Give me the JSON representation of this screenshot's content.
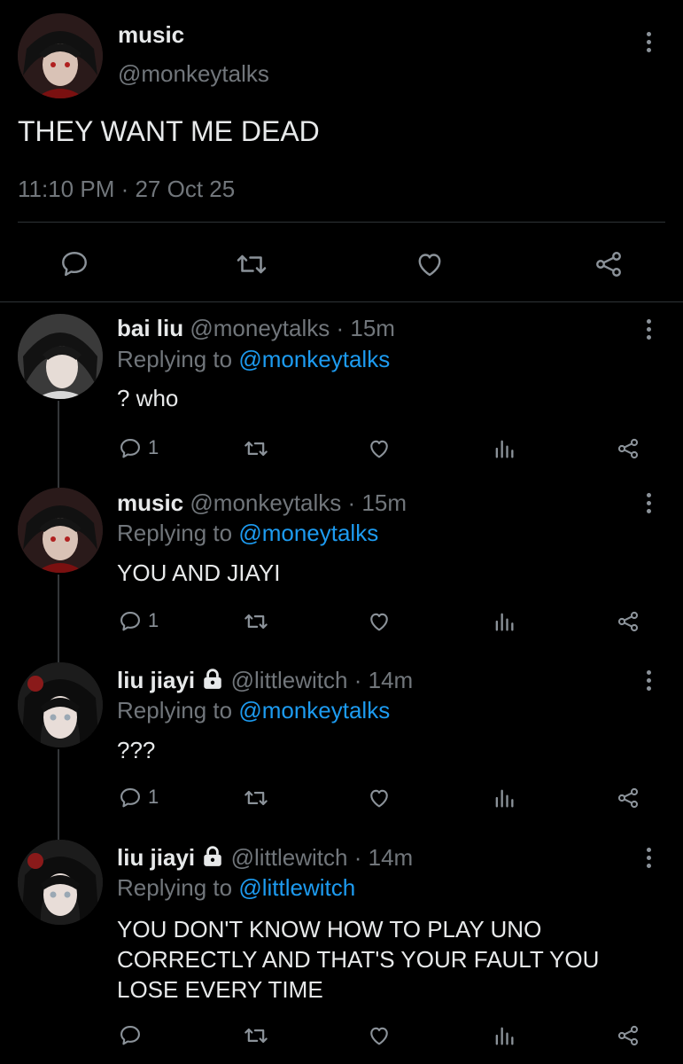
{
  "main_tweet": {
    "display_name": "music",
    "handle": "@monkeytalks",
    "text": "THEY WANT ME DEAD",
    "timestamp": "11:10 PM · 27 Oct 25"
  },
  "replies": [
    {
      "display_name": "bai liu",
      "handle": "@moneytalks",
      "time": "· 15m",
      "replying_prefix": "Replying to",
      "replying_to": "@monkeytalks",
      "text": "? who",
      "reply_count": "1"
    },
    {
      "display_name": "music",
      "handle": "@monkeytalks",
      "time": "· 15m",
      "replying_prefix": "Replying to",
      "replying_to": "@moneytalks",
      "text": "YOU AND JIAYI",
      "reply_count": "1"
    },
    {
      "display_name": "liu jiayi",
      "handle": "@littlewitch",
      "time": "· 14m",
      "replying_prefix": "Replying to",
      "replying_to": "@monkeytalks",
      "text": "???",
      "reply_count": "1",
      "locked": true
    },
    {
      "display_name": "liu jiayi",
      "handle": "@littlewitch",
      "time": "· 14m",
      "replying_prefix": "Replying to",
      "replying_to": "@littlewitch",
      "text_lines": [
        "YOU DON'T KNOW HOW TO PLAY UNO",
        "CORRECTLY AND THAT'S YOUR FAULT YOU",
        "LOSE EVERY TIME"
      ],
      "reply_count": "",
      "locked": true
    }
  ],
  "icons": {
    "reply": "comment-icon",
    "retweet": "retweet-icon",
    "like": "heart-icon",
    "views": "views-icon",
    "share": "share-icon",
    "more": "more-icon",
    "lock": "lock-icon"
  },
  "colors": {
    "background": "#000000",
    "text": "#e7e9ea",
    "muted": "#71767b",
    "link": "#1d9bf0",
    "icon": "#8b9299"
  }
}
